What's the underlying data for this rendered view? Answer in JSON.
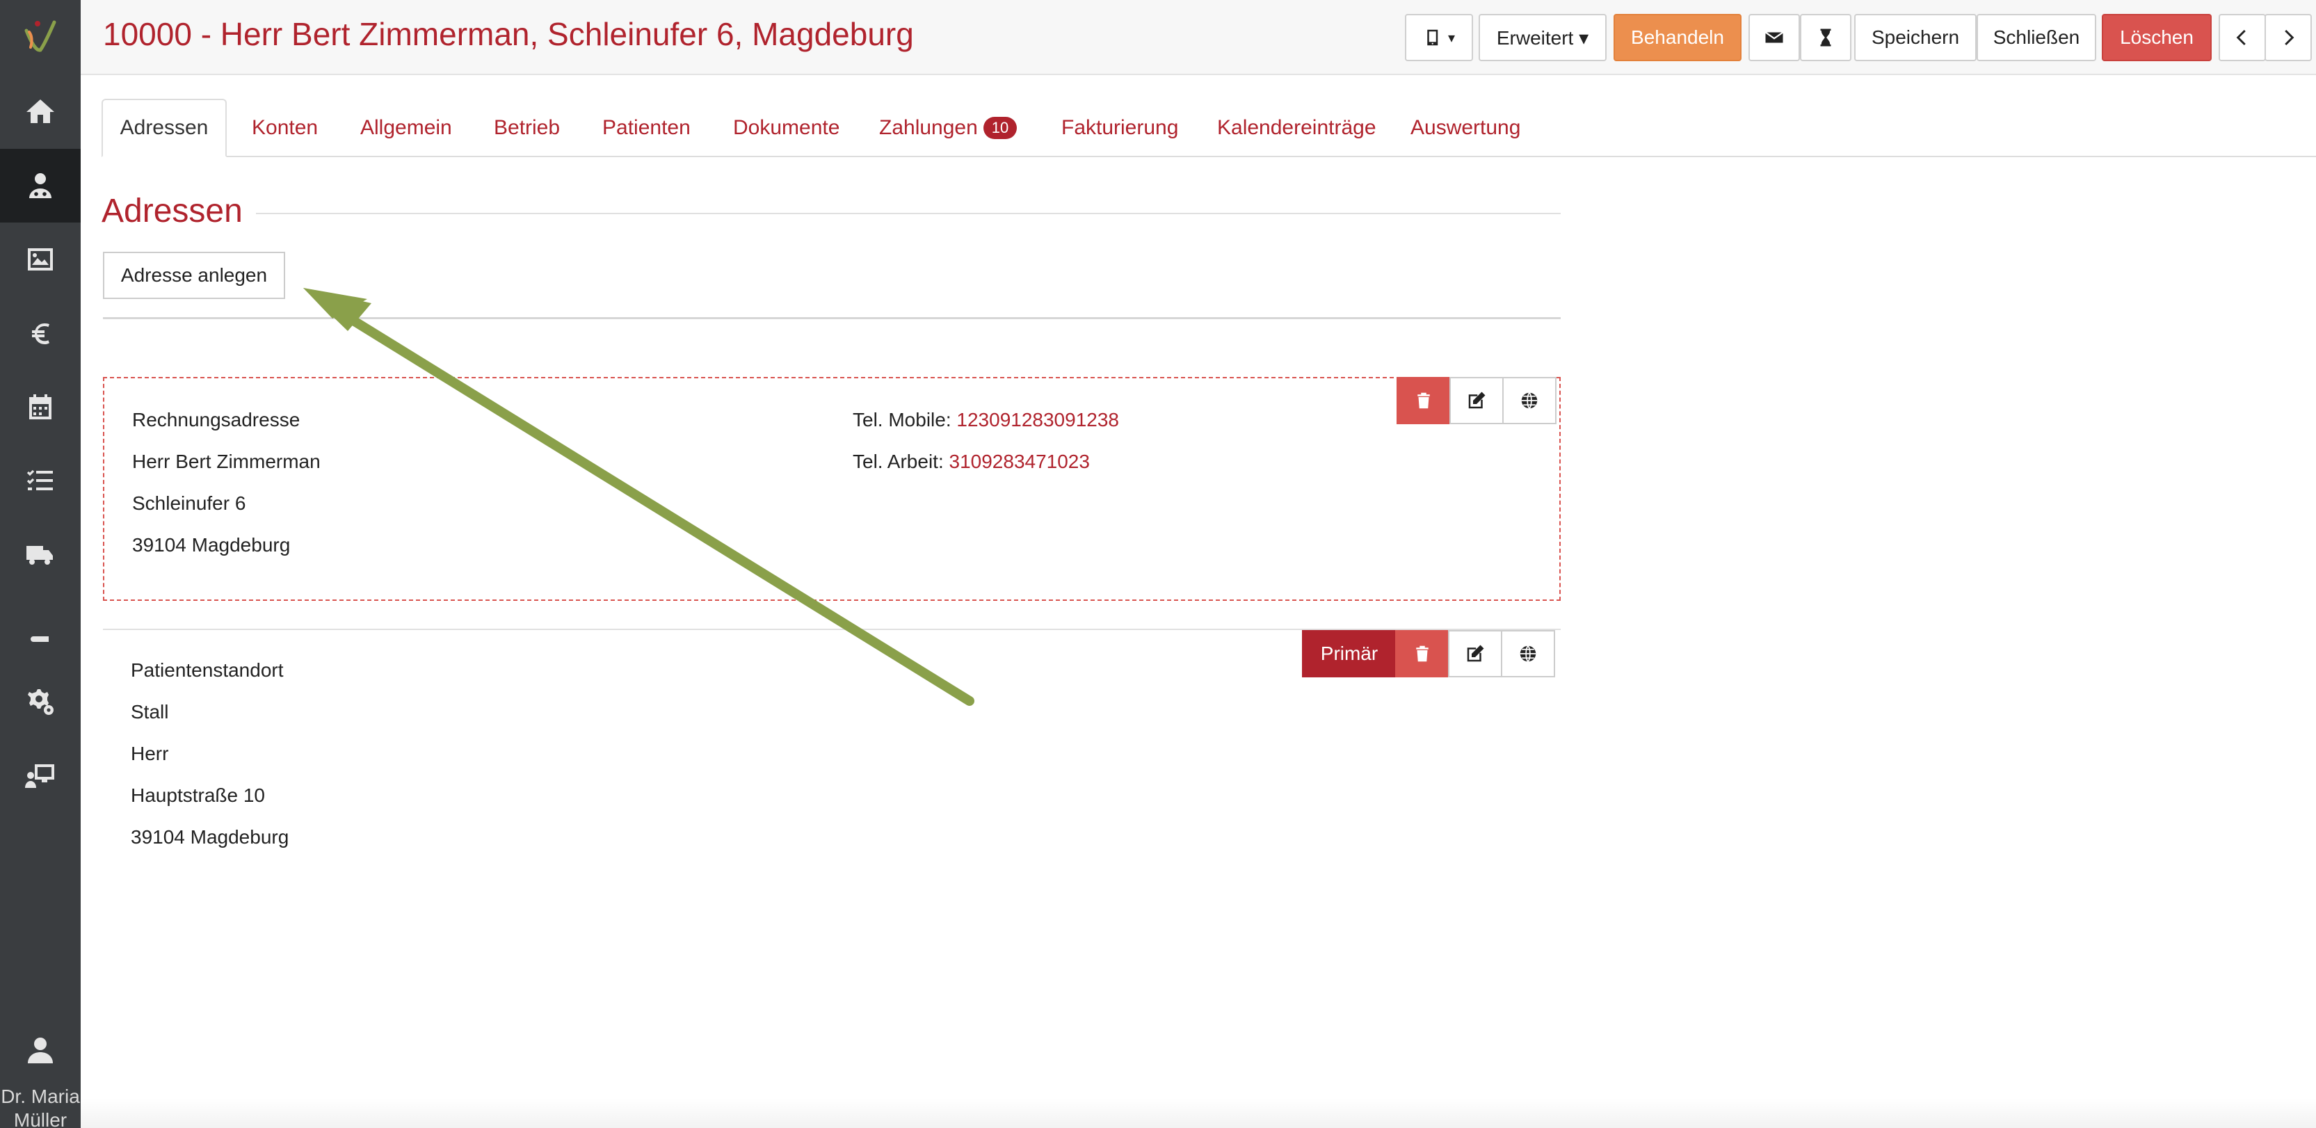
{
  "header": {
    "title": "10000 - Herr Bert Zimmerman, Schleinufer 6, Magdeburg",
    "buttons": {
      "erweitert": "Erweitert ▾",
      "behandeln": "Behandeln",
      "speichern": "Speichern",
      "schliessen": "Schließen",
      "loeschen": "Löschen"
    }
  },
  "sidebar": {
    "items": [
      "home-icon",
      "patient-icon",
      "gallery-icon",
      "euro-icon",
      "calendar-icon",
      "tasks-icon",
      "truck-icon",
      "book-icon",
      "settings-icon",
      "monitor-user-icon"
    ],
    "user": {
      "name": "Dr. Maria Müller"
    }
  },
  "tabs": [
    {
      "label": "Adressen",
      "active": true
    },
    {
      "label": "Konten"
    },
    {
      "label": "Allgemein"
    },
    {
      "label": "Betrieb"
    },
    {
      "label": "Patienten"
    },
    {
      "label": "Dokumente"
    },
    {
      "label": "Zahlungen",
      "badge": "10"
    },
    {
      "label": "Fakturierung"
    },
    {
      "label": "Kalendereinträge"
    },
    {
      "label": "Auswertung"
    }
  ],
  "section": {
    "title": "Adressen",
    "add_button": "Adresse anlegen"
  },
  "addresses": [
    {
      "type": "Rechnungsadresse",
      "name": "Herr Bert Zimmerman",
      "street": "Schleinufer 6",
      "city": "39104 Magdeburg",
      "phones": [
        {
          "label": "Tel. Mobile:",
          "value": "123091283091238"
        },
        {
          "label": "Tel. Arbeit:",
          "value": "3109283471023"
        }
      ]
    },
    {
      "type": "Patientenstandort",
      "line2": "Stall",
      "line3": "Herr",
      "street": "Hauptstraße 10",
      "city": "39104 Magdeburg",
      "primary_label": "Primär"
    }
  ],
  "colors": {
    "accent": "#b0232d",
    "sidebar": "#3a3d40",
    "orange": "#ec8f4e",
    "danger": "#d9534f",
    "arrow": "#8aa04a"
  }
}
